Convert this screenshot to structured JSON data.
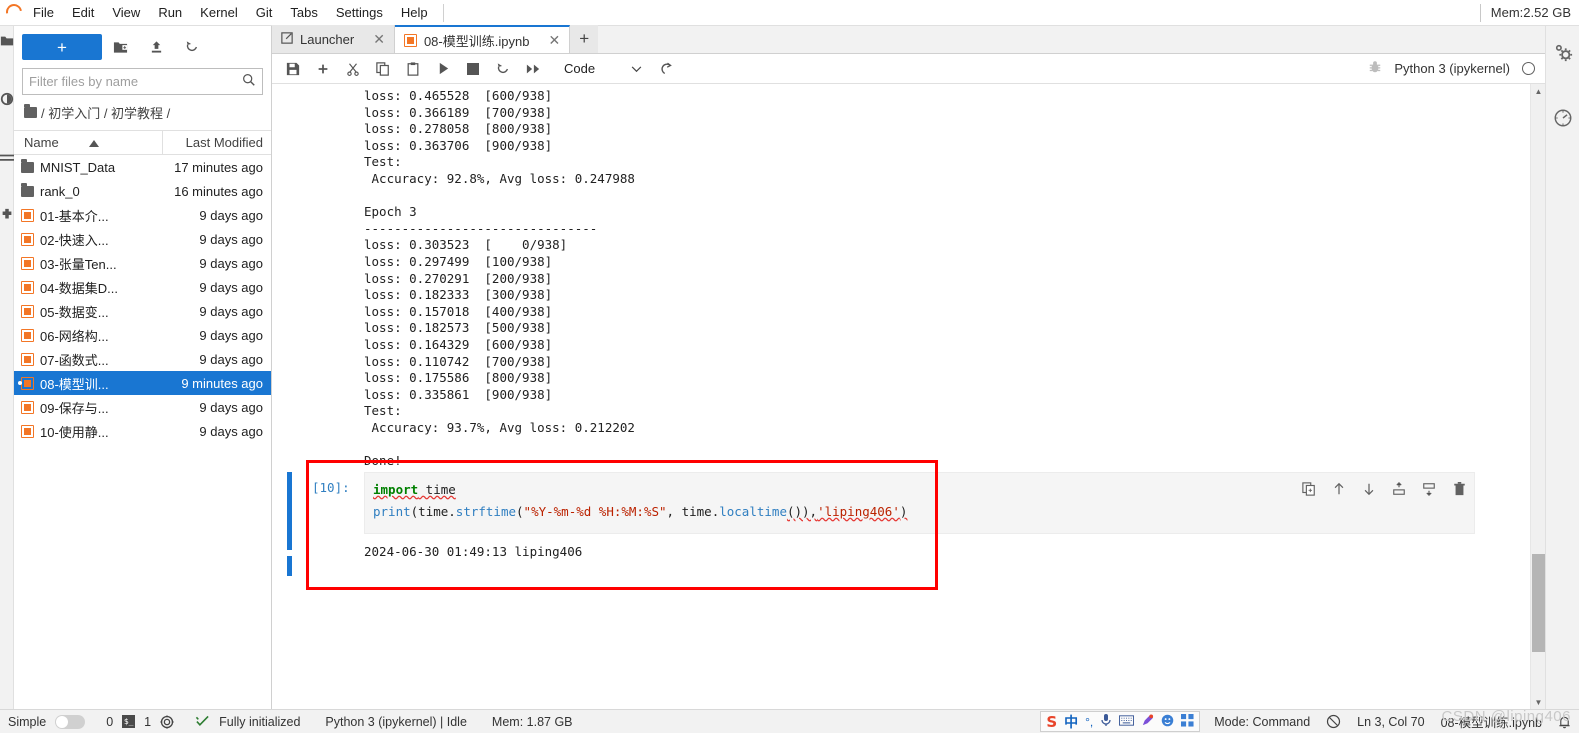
{
  "menubar": {
    "logo_icon": "jupyter-logo-icon",
    "items": [
      "File",
      "Edit",
      "View",
      "Run",
      "Kernel",
      "Git",
      "Tabs",
      "Settings",
      "Help"
    ],
    "memory": "Mem:2.52 GB"
  },
  "activitybar_left": {
    "icons": [
      "file-browser-icon",
      "running-terminals-icon",
      "commands-icon",
      "extensions-icon"
    ]
  },
  "activitybar_right": {
    "icons": [
      "property-inspector-gear-icon",
      "debugger-gauge-icon"
    ]
  },
  "filebrowser": {
    "new_launcher_label": "+",
    "toolbar_icons": [
      "new-folder-icon",
      "upload-icon",
      "refresh-icon"
    ],
    "filter": {
      "placeholder": "Filter files by name",
      "value": "",
      "icon": "search-icon"
    },
    "breadcrumb": {
      "home_icon": "folder-icon",
      "path": "/ 初学入门 / 初学教程 /"
    },
    "columns": {
      "name": "Name",
      "modified": "Last Modified",
      "sort_icon": "sort-ascending-icon"
    },
    "items": [
      {
        "name": "MNIST_Data",
        "modified": "17 minutes ago",
        "type": "folder",
        "selected": false
      },
      {
        "name": "rank_0",
        "modified": "16 minutes ago",
        "type": "folder",
        "selected": false
      },
      {
        "name": "01-基本介...",
        "modified": "9 days ago",
        "type": "notebook",
        "selected": false
      },
      {
        "name": "02-快速入...",
        "modified": "9 days ago",
        "type": "notebook",
        "selected": false
      },
      {
        "name": "03-张量Ten...",
        "modified": "9 days ago",
        "type": "notebook",
        "selected": false
      },
      {
        "name": "04-数据集D...",
        "modified": "9 days ago",
        "type": "notebook",
        "selected": false
      },
      {
        "name": "05-数据变...",
        "modified": "9 days ago",
        "type": "notebook",
        "selected": false
      },
      {
        "name": "06-网络构...",
        "modified": "9 days ago",
        "type": "notebook",
        "selected": false
      },
      {
        "name": "07-函数式...",
        "modified": "9 days ago",
        "type": "notebook",
        "selected": false
      },
      {
        "name": "08-模型训...",
        "modified": "9 minutes ago",
        "type": "notebook",
        "selected": true
      },
      {
        "name": "09-保存与...",
        "modified": "9 days ago",
        "type": "notebook",
        "selected": false
      },
      {
        "name": "10-使用静...",
        "modified": "9 days ago",
        "type": "notebook",
        "selected": false
      }
    ]
  },
  "tabs": [
    {
      "label": "Launcher",
      "icon": "launcher-icon",
      "active": false
    },
    {
      "label": "08-模型训练.ipynb",
      "icon": "notebook-icon",
      "active": true
    }
  ],
  "tab_add_label": "+",
  "notebook_toolbar": {
    "icons": [
      "save-icon",
      "insert-cell-icon",
      "cut-icon",
      "copy-icon",
      "paste-icon",
      "run-icon",
      "stop-icon",
      "restart-icon",
      "restart-run-all-icon"
    ],
    "cell_type": "Code",
    "chevron_icon": "chevron-down-icon",
    "interrupt_icon": "interrupt-loop-icon",
    "debug_icon": "bug-icon",
    "kernel_name": "Python 3 (ipykernel)",
    "kernel_status_icon": "kernel-idle-circle-icon"
  },
  "notebook": {
    "scroll_output": "loss: 0.465528  [600/938]\nloss: 0.366189  [700/938]\nloss: 0.278058  [800/938]\nloss: 0.363706  [900/938]\nTest:\n Accuracy: 92.8%, Avg loss: 0.247988\n\nEpoch 3\n-------------------------------\nloss: 0.303523  [    0/938]\nloss: 0.297499  [100/938]\nloss: 0.270291  [200/938]\nloss: 0.182333  [300/938]\nloss: 0.157018  [400/938]\nloss: 0.182573  [500/938]\nloss: 0.164329  [600/938]\nloss: 0.110742  [700/938]\nloss: 0.175586  [800/938]\nloss: 0.335861  [900/938]\nTest:\n Accuracy: 93.7%, Avg loss: 0.212202\n\nDone!",
    "cell": {
      "prompt": "[10]:",
      "code_line1_kw": "import",
      "code_line1_mod": " time",
      "code_print": "print",
      "code_p1": "(time.",
      "code_strftime": "strftime",
      "code_p2": "(",
      "code_fmt": "\"%Y-%m-%d %H:%M:%S\"",
      "code_p3": ", time.",
      "code_localtime": "localtime",
      "code_p4": "()),",
      "code_tag": "'liping406'",
      "code_p5": ")",
      "output": "2024-06-30 01:49:13 liping406"
    },
    "cell_tools": [
      "duplicate-cell-icon",
      "move-cell-up-icon",
      "move-cell-down-icon",
      "insert-cell-above-icon",
      "insert-cell-below-icon",
      "delete-cell-icon"
    ]
  },
  "annotation": {
    "color": "#ff0000"
  },
  "statusbar": {
    "simple_label": "Simple",
    "terminal_count": "0",
    "kernel_count": "1",
    "terminal_icon": "terminal-icon",
    "kernel_icon": "kernel-sessions-icon",
    "git_status_icon": "git-check-icon",
    "git_status": "Fully initialized",
    "kernel_info": "Python 3 (ipykernel) | Idle",
    "memory": "Mem: 1.87 GB",
    "ime": {
      "logo": "S",
      "mode": "中",
      "icons": [
        "punctuation-icon",
        "microphone-icon",
        "keyboard-icon",
        "color-pen-icon",
        "emoji-icon",
        "apps-icon"
      ]
    },
    "mode": "Mode: Command",
    "notification_icon": "notification-off-icon",
    "cursor": "Ln 3, Col 70",
    "filename": "08-模型训练.ipynb",
    "bell_icon": "bell-icon"
  },
  "watermark": "CSDN @liping406"
}
